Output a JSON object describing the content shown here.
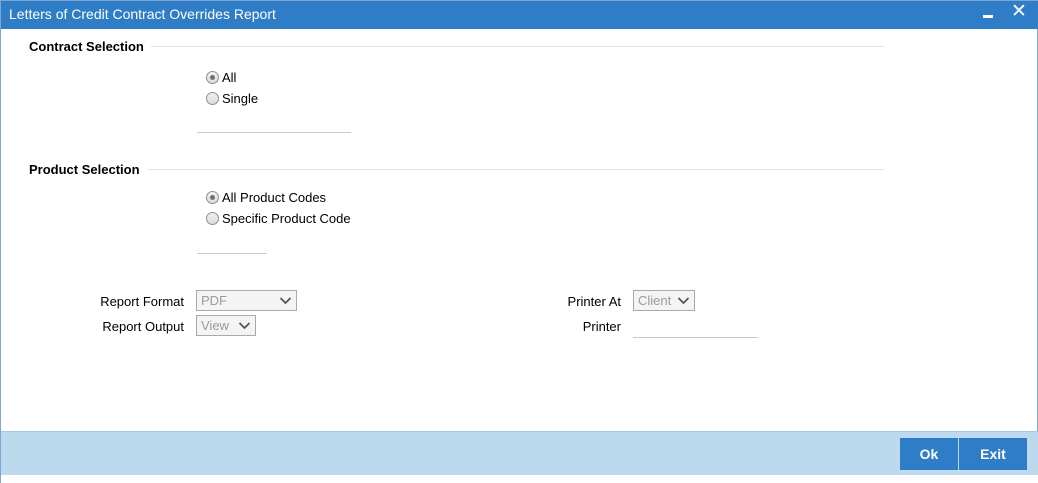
{
  "window": {
    "title": "Letters of Credit Contract Overrides Report",
    "minimize_glyph": "minimize-icon",
    "close_glyph": "✕"
  },
  "contract_selection": {
    "title": "Contract Selection",
    "options": [
      {
        "label": "All",
        "checked": true
      },
      {
        "label": "Single",
        "checked": false
      }
    ],
    "single_value": ""
  },
  "product_selection": {
    "title": "Product Selection",
    "options": [
      {
        "label": "All Product Codes",
        "checked": true
      },
      {
        "label": "Specific Product Code",
        "checked": false
      }
    ],
    "product_code_value": ""
  },
  "report": {
    "format_label": "Report Format",
    "format_value": "PDF",
    "output_label": "Report Output",
    "output_value": "View",
    "printer_at_label": "Printer At",
    "printer_at_value": "Client",
    "printer_label": "Printer",
    "printer_value": ""
  },
  "footer": {
    "ok_label": "Ok",
    "exit_label": "Exit"
  },
  "colors": {
    "titlebar": "#2f7dc6",
    "footer": "#bcd9ee",
    "button": "#2f7dc6"
  }
}
